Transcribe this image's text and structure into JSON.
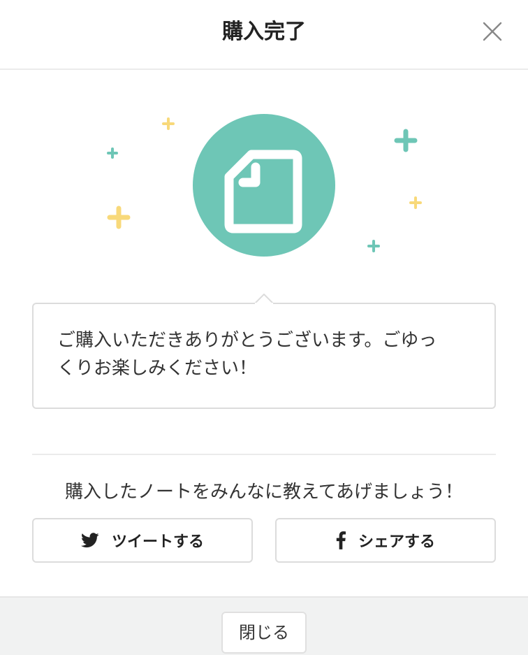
{
  "header": {
    "title": "購入完了"
  },
  "illustration": {
    "icon": "note-document-icon",
    "circle_color": "#6ec6b6",
    "sparkle_teal": "#6ec6b6",
    "sparkle_yellow": "#f8d97a"
  },
  "message": {
    "line1": "ご購入いただきありがとうございます。ごゆっ",
    "line2": "くりお楽しみください！"
  },
  "share": {
    "prompt": "購入したノートをみんなに教えてあげましょう！",
    "tweet_label": "ツイートする",
    "facebook_label": "シェアする"
  },
  "footer": {
    "close_label": "閉じる"
  }
}
